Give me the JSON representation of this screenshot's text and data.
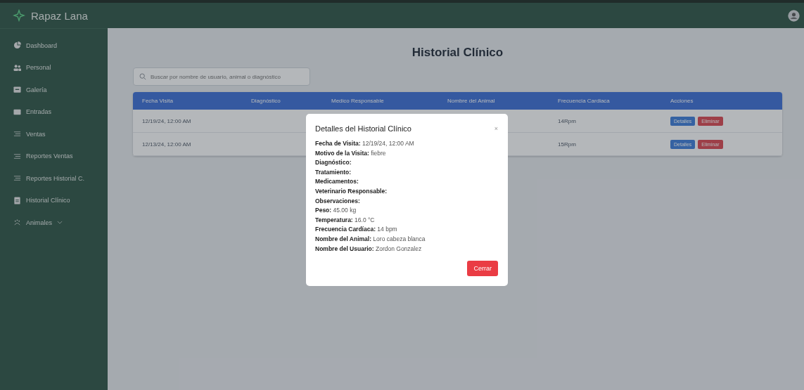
{
  "app": {
    "name": "Rapaz Lana"
  },
  "sidebar": {
    "items": [
      {
        "label": "Dashboard"
      },
      {
        "label": "Personal"
      },
      {
        "label": "Galería"
      },
      {
        "label": "Entradas"
      },
      {
        "label": "Ventas"
      },
      {
        "label": "Reportes Ventas"
      },
      {
        "label": "Reportes Historial C."
      },
      {
        "label": "Historial Clínico"
      },
      {
        "label": "Animales",
        "expanded": false
      }
    ]
  },
  "page": {
    "title": "Historial Clínico"
  },
  "search": {
    "placeholder": "Buscar por nombre de usuario, animal o diagnóstico"
  },
  "table": {
    "columns": [
      "Fecha Visita",
      "Diagnóstico",
      "Medico Responsable",
      "Nombre del Animal",
      "Frecuencia Cardiaca",
      "Acciones"
    ],
    "rows": [
      {
        "fecha": "12/19/24, 12:00 AM",
        "frecuencia": "14Rpm",
        "actions": [
          "Detalles",
          "Eliminar"
        ]
      },
      {
        "fecha": "12/13/24, 12:00 AM",
        "frecuencia": "15Rpm",
        "actions": [
          "Detalles",
          "Eliminar"
        ]
      }
    ]
  },
  "modal": {
    "title": "Detalles del Historial Clínico",
    "close": "×",
    "fields": [
      {
        "label": "Fecha de Visita:",
        "value": "12/19/24, 12:00 AM"
      },
      {
        "label": "Motivo de la Visita:",
        "value": "fiebre"
      },
      {
        "label": "Diagnóstico:"
      },
      {
        "label": "Tratamiento:"
      },
      {
        "label": "Medicamentos:"
      },
      {
        "label": "Veterinario Responsable:"
      },
      {
        "label": "Observaciones:"
      },
      {
        "label": "Peso:",
        "value": "45.00 kg"
      },
      {
        "label": "Temperatura:",
        "value": "16.0 °C"
      },
      {
        "label": "Frecuencia Cardíaca:",
        "value": "14 bpm"
      },
      {
        "label": "Nombre del Animal:",
        "value": "Loro cabeza blanca"
      },
      {
        "label": "Nombre del Usuario:",
        "value": "Zordon Gonzalez"
      }
    ],
    "button": "Cerrar"
  }
}
